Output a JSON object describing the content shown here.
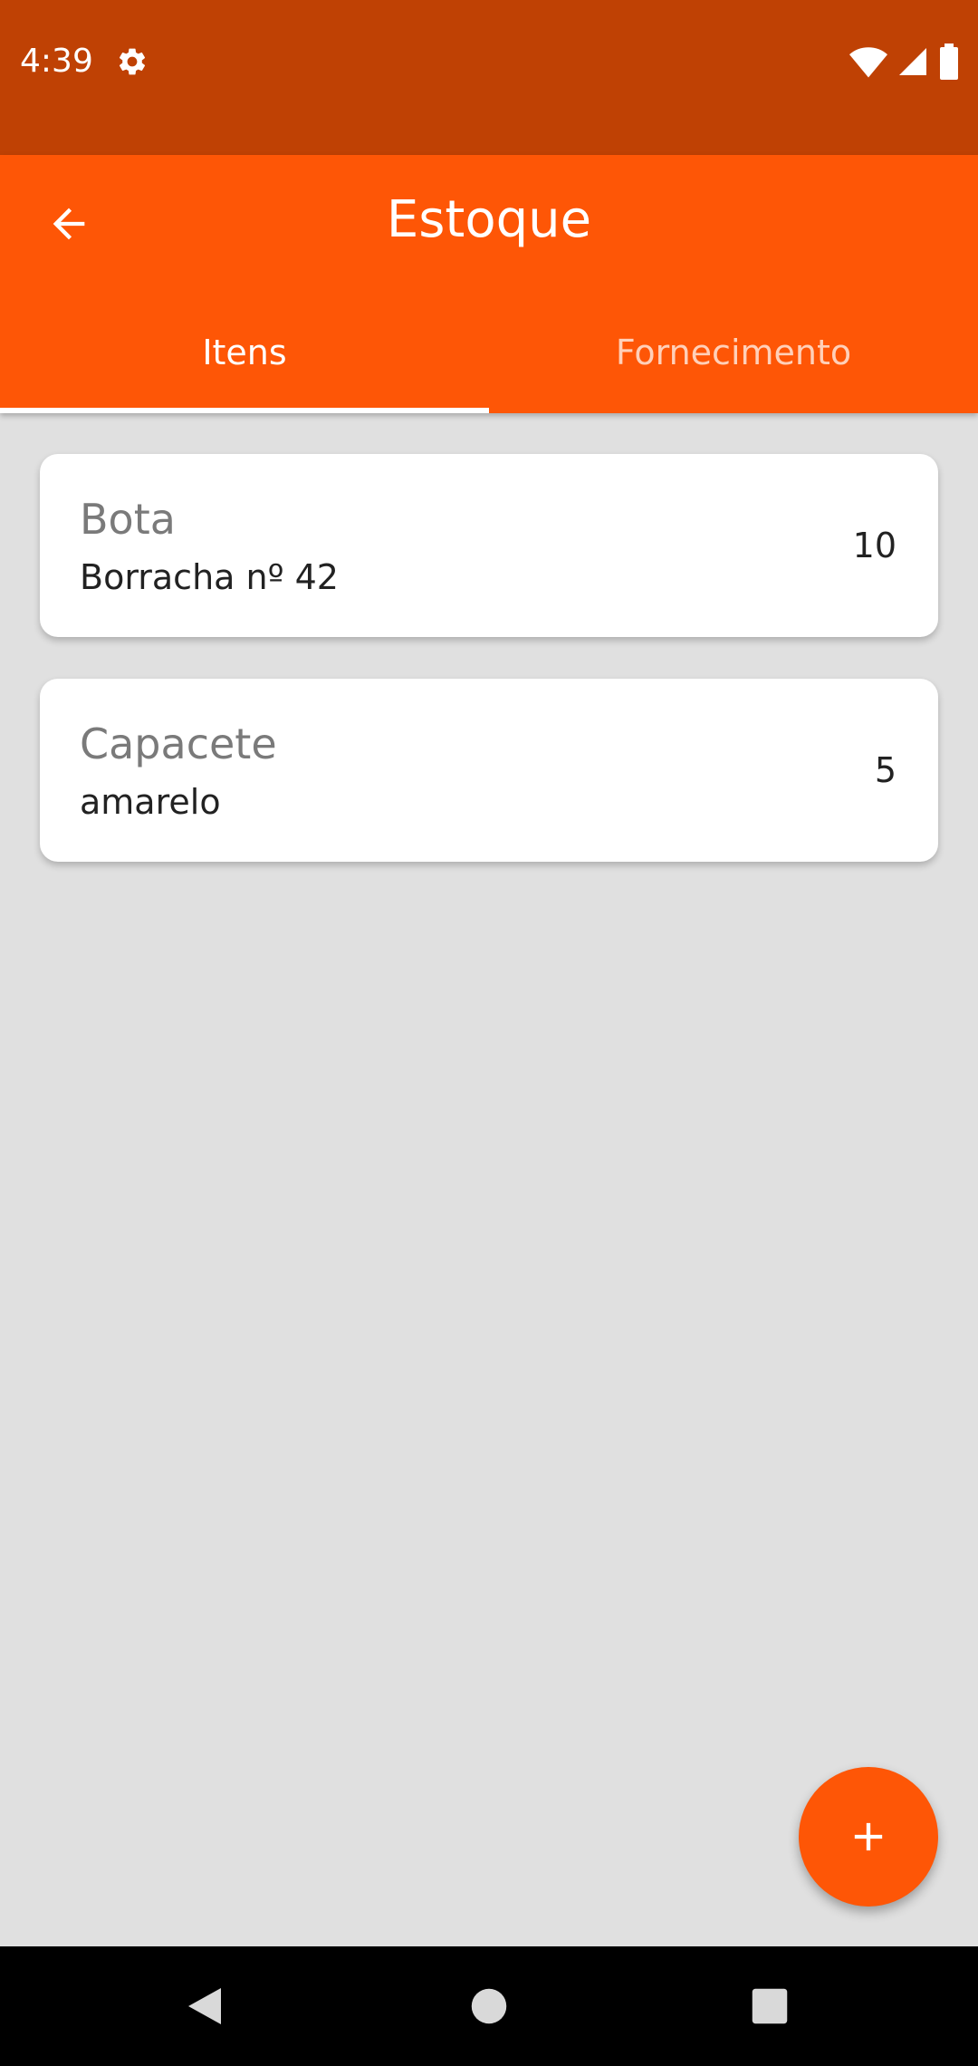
{
  "status_bar": {
    "time": "4:39",
    "icons": [
      "gear-icon",
      "wifi-icon",
      "signal-icon",
      "battery-icon"
    ]
  },
  "app_bar": {
    "title": "Estoque",
    "back_icon": "arrow-back-icon",
    "background_color": "#fe5606"
  },
  "tabs": [
    {
      "label": "Itens",
      "selected": true
    },
    {
      "label": "Fornecimento",
      "selected": false
    }
  ],
  "items": [
    {
      "name": "Bota",
      "description": "Borracha nº 42",
      "quantity": "10"
    },
    {
      "name": "Capacete",
      "description": "amarelo",
      "quantity": "5"
    }
  ],
  "fab": {
    "icon": "plus-icon"
  },
  "nav_bar": {
    "icons": [
      "back-triangle-icon",
      "home-circle-icon",
      "recents-square-icon"
    ]
  },
  "colors": {
    "status_bar": "#bf4104",
    "accent": "#fe5606",
    "background": "#e0e0e0"
  }
}
